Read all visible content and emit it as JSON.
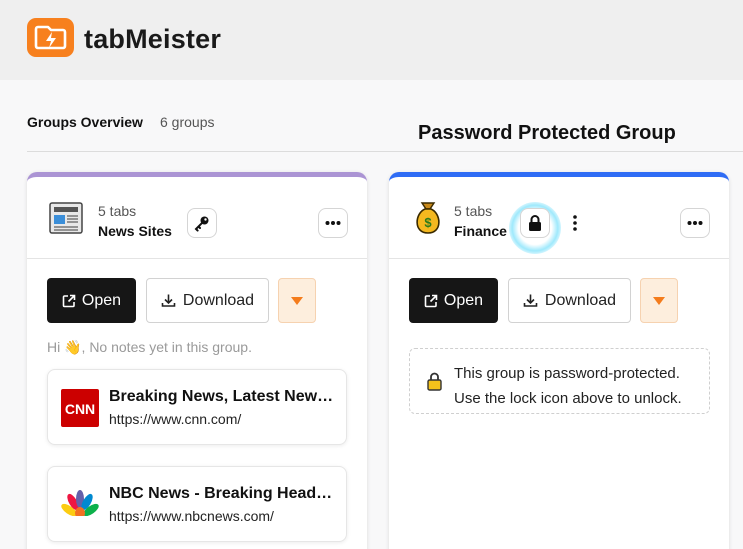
{
  "app": {
    "title": "tabMeister",
    "accent_color": "#f7801e"
  },
  "overview": {
    "title": "Groups Overview",
    "count": "6 groups"
  },
  "annotation": {
    "heading": "Password Protected Group"
  },
  "groups": [
    {
      "name": "News Sites",
      "tab_count": "5 tabs",
      "icon": "newspaper-icon",
      "accent_color": "#ab94d4",
      "open_label": "Open",
      "download_label": "Download",
      "notes": "Hi 👋, No notes yet in this group.",
      "tabs": [
        {
          "title": "Breaking News, Latest News and Videos | CNN",
          "url": "https://www.cnn.com/",
          "favicon": "cnn-logo",
          "favicon_text": "CNN"
        },
        {
          "title": "NBC News - Breaking Headlines and Video Reports",
          "url": "https://www.nbcnews.com/",
          "favicon": "nbc-peacock-logo"
        }
      ]
    },
    {
      "name": "Finance",
      "tab_count": "5 tabs",
      "icon": "money-bag-icon",
      "icon_text": "$",
      "accent_color": "#2f6cf5",
      "open_label": "Open",
      "download_label": "Download",
      "locked_message_1": "This group is password-protected.",
      "locked_message_2": "Use the lock icon above to unlock."
    }
  ]
}
